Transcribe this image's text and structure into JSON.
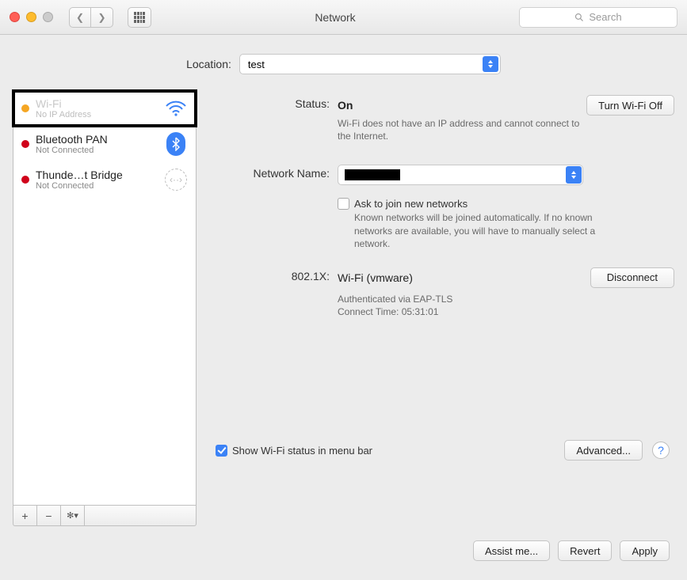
{
  "window": {
    "title": "Network",
    "search_placeholder": "Search"
  },
  "location": {
    "label": "Location:",
    "value": "test"
  },
  "sidebar": {
    "items": [
      {
        "name": "Wi-Fi",
        "sub": "No IP Address",
        "status": "yellow",
        "icon": "wifi"
      },
      {
        "name": "Bluetooth PAN",
        "sub": "Not Connected",
        "status": "red",
        "icon": "bluetooth"
      },
      {
        "name": "Thunde…t Bridge",
        "sub": "Not Connected",
        "status": "red",
        "icon": "thunderbolt"
      }
    ],
    "footer": {
      "add": "+",
      "remove": "−",
      "gear": "✻▾"
    }
  },
  "status": {
    "label": "Status:",
    "value": "On",
    "toggle_button": "Turn Wi-Fi Off",
    "help": "Wi-Fi does not have an IP address and cannot connect to the Internet."
  },
  "network_name": {
    "label": "Network Name:",
    "ask_check_label": "Ask to join new networks",
    "ask_help": "Known networks will be joined automatically. If no known networks are available, you will have to manually select a network."
  },
  "eap": {
    "label": "802.1X:",
    "profile": "Wi-Fi (vmware)",
    "disconnect": "Disconnect",
    "auth_line": "Authenticated via EAP-TLS",
    "time_line": "Connect Time: 05:31:01"
  },
  "menubar_check": {
    "label": "Show Wi-Fi status in menu bar"
  },
  "advanced": {
    "label": "Advanced..."
  },
  "actions": {
    "assist": "Assist me...",
    "revert": "Revert",
    "apply": "Apply"
  }
}
